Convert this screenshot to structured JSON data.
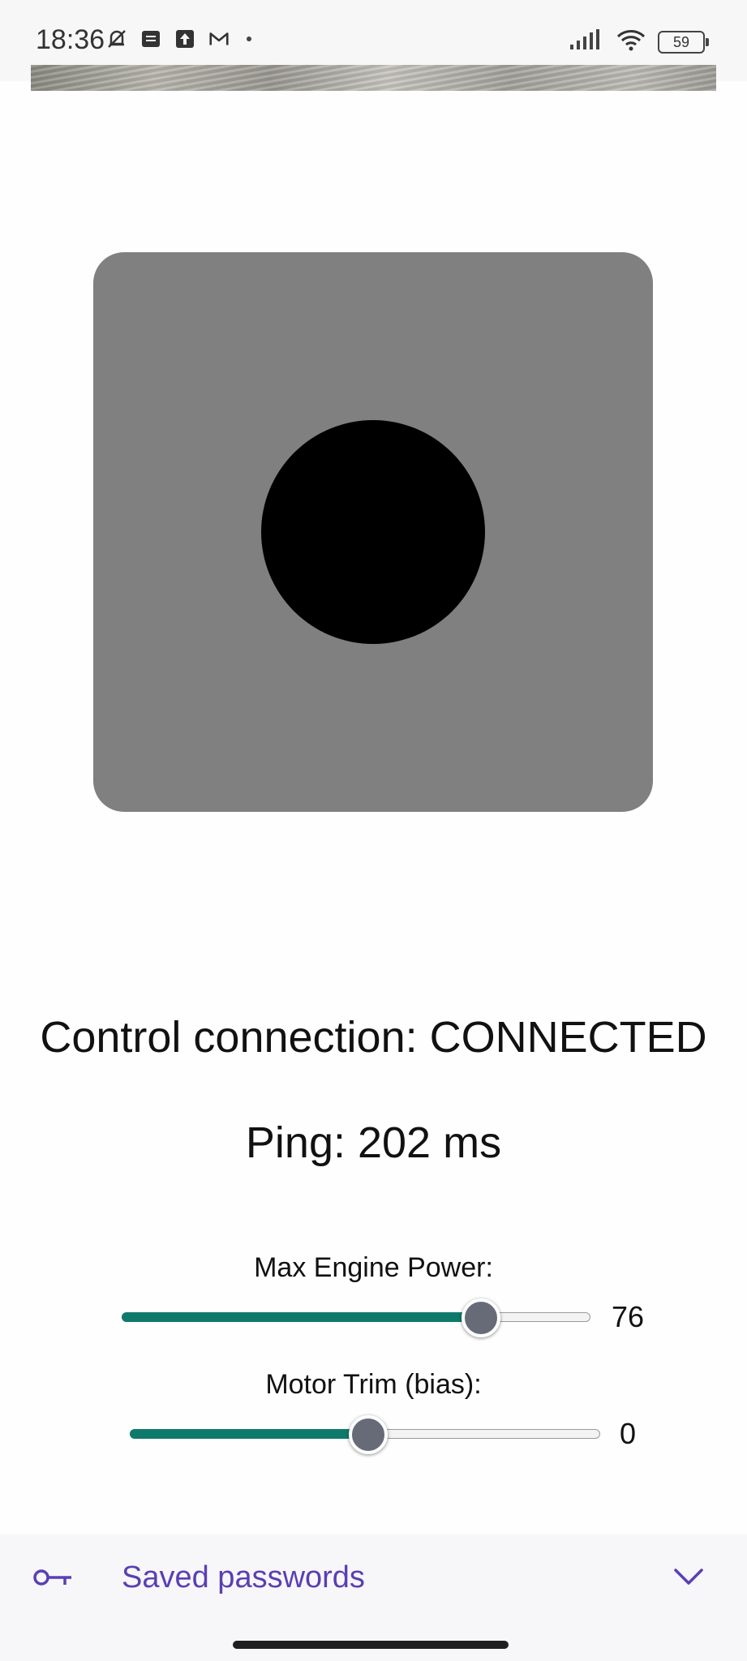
{
  "status_bar": {
    "time": "18:36",
    "battery_level": "59",
    "icons_left": [
      "mute-bell-icon",
      "notes-icon",
      "upload-icon",
      "gmail-icon"
    ],
    "icons_right": [
      "signal-icon",
      "wifi-icon",
      "battery-icon"
    ]
  },
  "controls": {
    "connection_status": "Control connection: CONNECTED",
    "ping": "Ping: 202 ms",
    "max_engine_power": {
      "label": "Max Engine Power:",
      "value": "76",
      "fill_fraction": 0.76
    },
    "motor_trim": {
      "label": "Motor Trim (bias):",
      "value": "0",
      "fill_fraction": 0.5
    }
  },
  "colors": {
    "pad": "#808080",
    "knob": "#000000",
    "slider_fill": "#0f7a6c",
    "slider_thumb": "#676b78",
    "password_accent": "#5a3fb3"
  },
  "password_bar": {
    "label": "Saved passwords",
    "icon": "key-icon",
    "expand_icon": "chevron-down-icon"
  }
}
